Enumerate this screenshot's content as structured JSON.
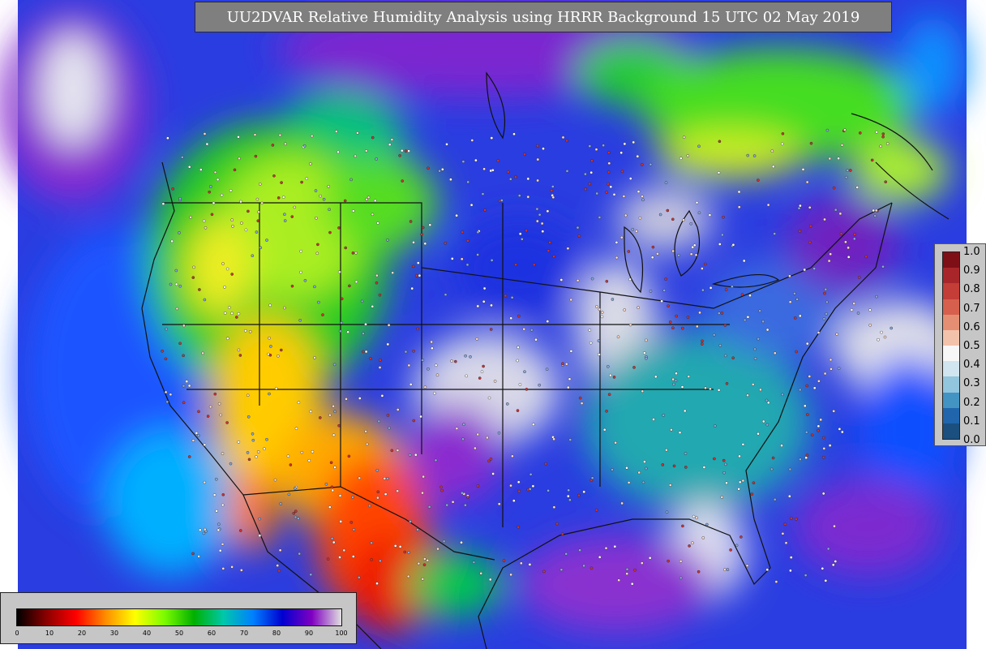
{
  "map": {
    "title": "UU2DVAR Relative Humidity Analysis using HRRR Background 15 UTC 02 May 2019",
    "field": "relative humidity"
  },
  "legend_right": {
    "ticks": [
      "1.0",
      "0.9",
      "0.8",
      "0.7",
      "0.6",
      "0.5",
      "0.4",
      "0.3",
      "0.2",
      "0.1",
      "0.0"
    ],
    "colors": [
      "#7f0f16",
      "#a8262a",
      "#c43d37",
      "#d6604d",
      "#e58e73",
      "#f3c2ab",
      "#f7f7f7",
      "#d1e5f0",
      "#92c5de",
      "#4393c3",
      "#2166ac",
      "#1a4f7f"
    ]
  },
  "legend_bottom": {
    "ticks": [
      "0",
      "10",
      "20",
      "30",
      "40",
      "50",
      "60",
      "70",
      "80",
      "90",
      "100"
    ],
    "colors": [
      "#000000",
      "#8b0000",
      "#ff0000",
      "#ff8c00",
      "#ffff00",
      "#7cfc00",
      "#00b000",
      "#00c8aa",
      "#0080ff",
      "#0000d0",
      "#8000c0",
      "#e0e0e0"
    ]
  }
}
